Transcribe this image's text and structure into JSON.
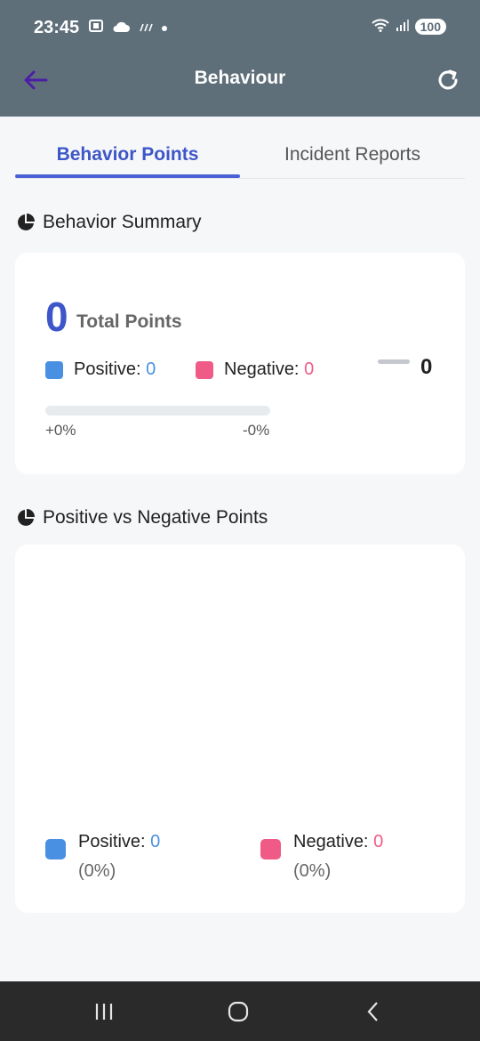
{
  "status_bar": {
    "time": "23:45",
    "battery": "100",
    "icons_left": [
      "screenshot-icon",
      "cloud-icon",
      "rain-icon",
      "dot-icon"
    ],
    "icons_right": [
      "wifi-icon",
      "signal-icon",
      "battery-icon"
    ]
  },
  "appbar": {
    "title": "Behaviour",
    "back_icon": "arrow-left-icon",
    "refresh_icon": "refresh-icon"
  },
  "tabs": [
    {
      "label": "Behavior Points",
      "active": true
    },
    {
      "label": "Incident Reports",
      "active": false
    }
  ],
  "summary": {
    "section_title": "Behavior Summary",
    "total_value": "0",
    "total_label": "Total Points",
    "positive_label": "Positive:",
    "positive_value": "0",
    "negative_label": "Negative:",
    "negative_value": "0",
    "net_value": "0",
    "positive_pct": "+0%",
    "negative_pct": "-0%",
    "progress_fraction": 0
  },
  "comparison": {
    "section_title": "Positive vs Negative Points",
    "positive_label": "Positive:",
    "positive_value": "0",
    "positive_pct": "(0%)",
    "negative_label": "Negative:",
    "negative_value": "0",
    "negative_pct": "(0%)"
  },
  "colors": {
    "accent": "#3d56c9",
    "positive": "#4a90e2",
    "negative": "#ef5b86",
    "header": "#5f6f7a"
  }
}
